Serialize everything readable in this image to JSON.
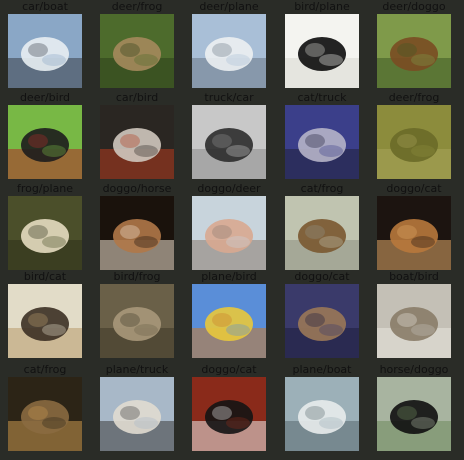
{
  "grid": {
    "rows": 5,
    "cols": 5,
    "cells": [
      {
        "label": "car/boat",
        "image": "white-car-photo",
        "colors": [
          "#8aa7c6",
          "#e8eef2",
          "#3a4048"
        ]
      },
      {
        "label": "deer/frog",
        "image": "frog-in-grass-photo",
        "colors": [
          "#4d6b2c",
          "#a58a5c",
          "#2d3f1b"
        ]
      },
      {
        "label": "deer/plane",
        "image": "jet-plane-photo",
        "colors": [
          "#a9bfd7",
          "#eceff2",
          "#6b7887"
        ]
      },
      {
        "label": "bird/plane",
        "image": "black-plane-on-white",
        "colors": [
          "#f4f4f0",
          "#0c0c0c",
          "#d8d8d2"
        ]
      },
      {
        "label": "deer/doggo",
        "image": "dog-on-grass-photo",
        "colors": [
          "#7f9a4a",
          "#7a4c22",
          "#3e5a24"
        ]
      },
      {
        "label": "deer/bird",
        "image": "black-chicken-photo",
        "colors": [
          "#78b845",
          "#1d1d1d",
          "#b02a2a"
        ]
      },
      {
        "label": "car/bird",
        "image": "emu-face-photo",
        "colors": [
          "#2a2622",
          "#cfc8be",
          "#b23a1e"
        ]
      },
      {
        "label": "truck/car",
        "image": "vintage-car-photo",
        "colors": [
          "#c8c8c8",
          "#2c2c2c",
          "#8c8c8c"
        ]
      },
      {
        "label": "cat/truck",
        "image": "old-truck-photo",
        "colors": [
          "#3b3f8a",
          "#b6b4c8",
          "#20203a"
        ]
      },
      {
        "label": "deer/frog",
        "image": "frog-in-moss-photo",
        "colors": [
          "#8c8c3c",
          "#6a6a28",
          "#a8a45a"
        ]
      },
      {
        "label": "frog/plane",
        "image": "stealth-plane-photo",
        "colors": [
          "#4b4f2a",
          "#e6dcc0",
          "#2f321a"
        ]
      },
      {
        "label": "doggo/horse",
        "image": "horse-head-photo",
        "colors": [
          "#1a120c",
          "#b07848",
          "#f0e2d0"
        ]
      },
      {
        "label": "doggo/deer",
        "image": "pale-dog-closeup-photo",
        "colors": [
          "#c8d4dc",
          "#d8a890",
          "#8a7a70"
        ]
      },
      {
        "label": "cat/frog",
        "image": "cat-lying-photo",
        "colors": [
          "#c0c4b0",
          "#7a5830",
          "#8e9284"
        ]
      },
      {
        "label": "doggo/cat",
        "image": "dog-lying-photo",
        "colors": [
          "#1c1410",
          "#b8783c",
          "#e0a868"
        ]
      },
      {
        "label": "bird/cat",
        "image": "cat-on-table-photo",
        "colors": [
          "#e2dcc8",
          "#3c3024",
          "#b89a6c"
        ]
      },
      {
        "label": "bird/frog",
        "image": "toad-photo",
        "colors": [
          "#6a6048",
          "#a8987a",
          "#3e3828"
        ]
      },
      {
        "label": "plane/bird",
        "image": "yellow-bird-photo",
        "colors": [
          "#5a8ed8",
          "#e8c83c",
          "#c87a2c"
        ]
      },
      {
        "label": "doggo/cat",
        "image": "cat-sitting-photo",
        "colors": [
          "#3a3a6a",
          "#9a7858",
          "#1e1e3c"
        ]
      },
      {
        "label": "boat/bird",
        "image": "shorebird-photo",
        "colors": [
          "#c4c0b6",
          "#8a7c68",
          "#e8e4dc"
        ]
      },
      {
        "label": "cat/frog",
        "image": "brown-frog-photo",
        "colors": [
          "#2c2416",
          "#8a6a40",
          "#c89850"
        ]
      },
      {
        "label": "plane/truck",
        "image": "truck-trailer-photo",
        "colors": [
          "#a8b8c8",
          "#e0dcd0",
          "#3c3c3c"
        ]
      },
      {
        "label": "doggo/cat",
        "image": "black-white-cat-photo",
        "colors": [
          "#8a2a1a",
          "#141414",
          "#e8e8e8"
        ]
      },
      {
        "label": "plane/boat",
        "image": "white-ship-photo",
        "colors": [
          "#9cb0b8",
          "#e8ecec",
          "#5a6a70"
        ]
      },
      {
        "label": "horse/doggo",
        "image": "black-dog-photo",
        "colors": [
          "#a8b4a0",
          "#101010",
          "#6e8a5c"
        ]
      }
    ]
  }
}
